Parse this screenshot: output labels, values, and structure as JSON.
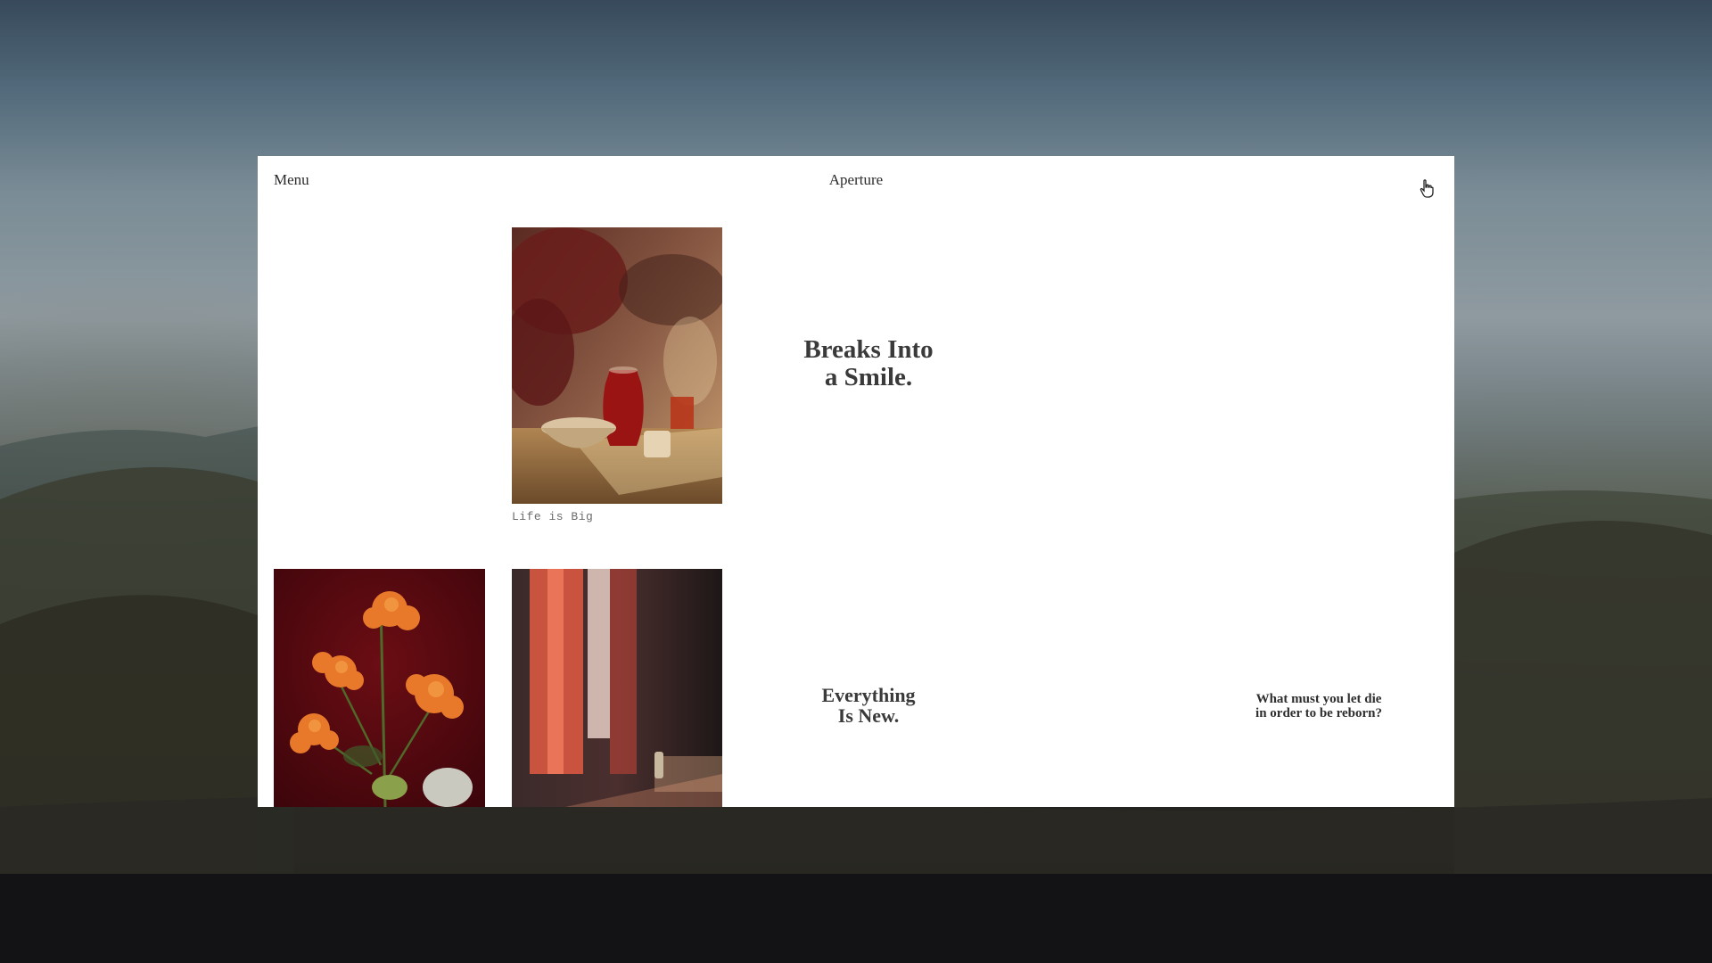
{
  "header": {
    "menu_label": "Menu",
    "brand": "Aperture",
    "cursor_icon": "hand-pointer-icon"
  },
  "gallery": {
    "caption_1": "Life is Big",
    "headline_1_line1": "Breaks Into",
    "headline_1_line2": "a Smile.",
    "headline_2_line1": "Everything",
    "headline_2_line2": "Is New.",
    "question_line1": "What must you let die",
    "question_line2": "in order to be reborn?"
  },
  "colors": {
    "page_background": "#ffffff",
    "text": "#2b2b2b",
    "caption": "#6b6b6b",
    "flower_backdrop": "#5a0a10",
    "flower_petals": "#e8782a"
  }
}
